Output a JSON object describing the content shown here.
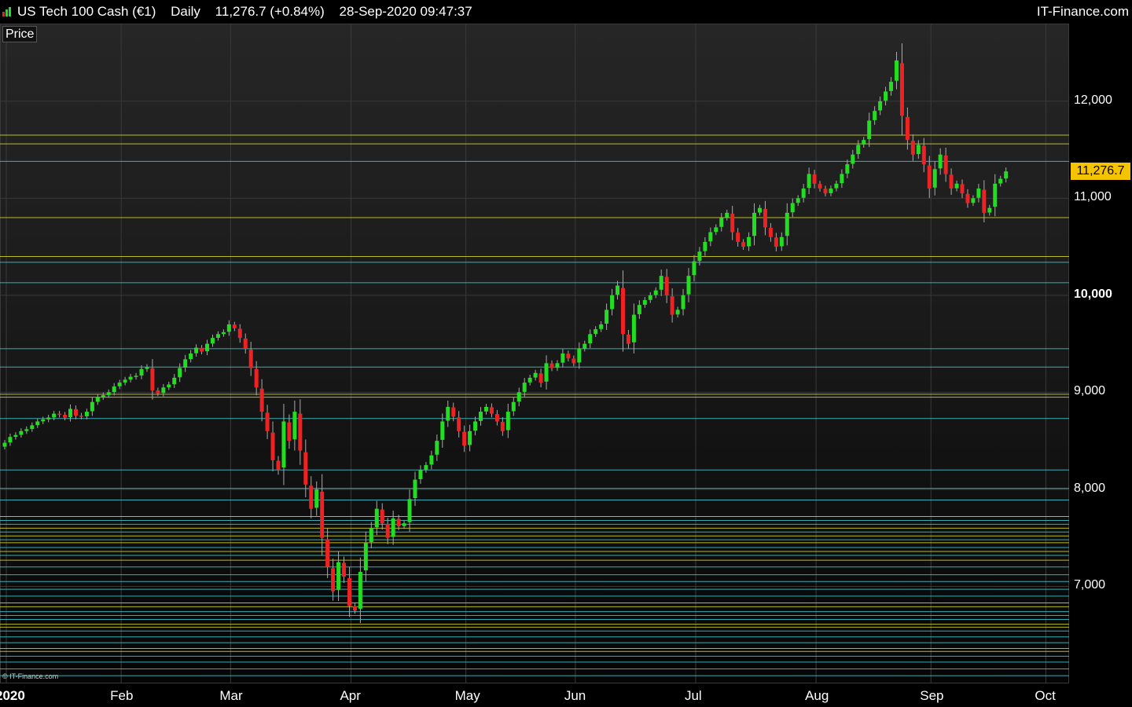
{
  "header": {
    "instrument": "US Tech 100 Cash (€1)",
    "period": "Daily",
    "quote": "11,276.7 (+0.84%)",
    "datetime": "28-Sep-2020 09:47:37",
    "brand": "IT-Finance.com"
  },
  "panel_label": "Price",
  "copyright": "© IT-Finance.com",
  "last_price_label": "11,276.7",
  "colors": {
    "up": "#22dd22",
    "down": "#ee2222",
    "level_yellow": "#d8d820",
    "level_cyan": "#40c8d0",
    "badge": "#f5c400"
  },
  "chart_data": {
    "type": "candlestick",
    "ylim": [
      6000,
      12800
    ],
    "y_ticks": [
      {
        "value": 12000,
        "label": "12,000",
        "bold": false
      },
      {
        "value": 11000,
        "label": "11,000",
        "bold": false
      },
      {
        "value": 10000,
        "label": "10,000",
        "bold": true
      },
      {
        "value": 9000,
        "label": "9,000",
        "bold": false
      },
      {
        "value": 8000,
        "label": "8,000",
        "bold": false
      },
      {
        "value": 7000,
        "label": "7,000",
        "bold": false
      }
    ],
    "x_ticks": [
      {
        "label": "2020",
        "bold": true,
        "index": 0
      },
      {
        "label": "Feb",
        "bold": false,
        "index": 21
      },
      {
        "label": "Mar",
        "bold": false,
        "index": 41
      },
      {
        "label": "Apr",
        "bold": false,
        "index": 63
      },
      {
        "label": "May",
        "bold": false,
        "index": 84
      },
      {
        "label": "Jun",
        "bold": false,
        "index": 104
      },
      {
        "label": "Jul",
        "bold": false,
        "index": 126
      },
      {
        "label": "Aug",
        "bold": false,
        "index": 148
      },
      {
        "label": "Sep",
        "bold": false,
        "index": 169
      },
      {
        "label": "Oct",
        "bold": false,
        "index": 190
      }
    ],
    "last_price": 11276.7,
    "horizontal_levels": [
      {
        "value": 11650,
        "color": "yellow"
      },
      {
        "value": 11560,
        "color": "yellow"
      },
      {
        "value": 11380,
        "color": "cyan"
      },
      {
        "value": 10800,
        "color": "yellow"
      },
      {
        "value": 10400,
        "color": "yellow"
      },
      {
        "value": 10340,
        "color": "cyan"
      },
      {
        "value": 10130,
        "color": "cyan"
      },
      {
        "value": 9450,
        "color": "cyan"
      },
      {
        "value": 9260,
        "color": "cyan"
      },
      {
        "value": 8980,
        "color": "yellow"
      },
      {
        "value": 8950,
        "color": "yellow"
      },
      {
        "value": 8730,
        "color": "cyan"
      },
      {
        "value": 8200,
        "color": "cyan"
      },
      {
        "value": 8010,
        "color": "cyan"
      },
      {
        "value": 7890,
        "color": "cyan"
      },
      {
        "value": 7720,
        "color": "yellow"
      },
      {
        "value": 7680,
        "color": "cyan"
      },
      {
        "value": 7640,
        "color": "cyan"
      },
      {
        "value": 7600,
        "color": "yellow"
      },
      {
        "value": 7560,
        "color": "cyan"
      },
      {
        "value": 7520,
        "color": "yellow"
      },
      {
        "value": 7480,
        "color": "cyan"
      },
      {
        "value": 7450,
        "color": "yellow"
      },
      {
        "value": 7400,
        "color": "cyan"
      },
      {
        "value": 7360,
        "color": "yellow"
      },
      {
        "value": 7320,
        "color": "cyan"
      },
      {
        "value": 7270,
        "color": "yellow"
      },
      {
        "value": 7200,
        "color": "cyan"
      },
      {
        "value": 7120,
        "color": "cyan"
      },
      {
        "value": 7050,
        "color": "cyan"
      },
      {
        "value": 6970,
        "color": "cyan"
      },
      {
        "value": 6900,
        "color": "cyan"
      },
      {
        "value": 6830,
        "color": "yellow"
      },
      {
        "value": 6790,
        "color": "yellow"
      },
      {
        "value": 6740,
        "color": "cyan"
      },
      {
        "value": 6700,
        "color": "cyan"
      },
      {
        "value": 6660,
        "color": "cyan"
      },
      {
        "value": 6610,
        "color": "yellow"
      },
      {
        "value": 6580,
        "color": "yellow"
      },
      {
        "value": 6540,
        "color": "cyan"
      },
      {
        "value": 6480,
        "color": "cyan"
      },
      {
        "value": 6420,
        "color": "cyan"
      },
      {
        "value": 6360,
        "color": "yellow"
      },
      {
        "value": 6330,
        "color": "yellow"
      },
      {
        "value": 6280,
        "color": "cyan"
      },
      {
        "value": 6220,
        "color": "cyan"
      },
      {
        "value": 6150,
        "color": "cyan"
      },
      {
        "value": 6080,
        "color": "cyan"
      }
    ],
    "closes": [
      8480,
      8540,
      8560,
      8600,
      8620,
      8660,
      8700,
      8720,
      8740,
      8780,
      8770,
      8740,
      8830,
      8760,
      8750,
      8800,
      8900,
      8950,
      8970,
      9000,
      9060,
      9100,
      9130,
      9160,
      9170,
      9240,
      9260,
      9020,
      8990,
      9050,
      9080,
      9150,
      9250,
      9340,
      9400,
      9460,
      9420,
      9500,
      9560,
      9600,
      9620,
      9700,
      9660,
      9560,
      9450,
      9250,
      9050,
      8800,
      8600,
      8300,
      8200,
      8700,
      8500,
      8800,
      8400,
      8050,
      7800,
      8000,
      7500,
      7200,
      6950,
      7250,
      7100,
      6800,
      6750,
      7150,
      7450,
      7600,
      7800,
      7650,
      7500,
      7700,
      7620,
      7650,
      7900,
      8100,
      8200,
      8250,
      8350,
      8500,
      8700,
      8850,
      8750,
      8600,
      8450,
      8600,
      8700,
      8800,
      8850,
      8780,
      8700,
      8600,
      8800,
      8900,
      9000,
      9100,
      9150,
      9200,
      9100,
      9300,
      9250,
      9300,
      9400,
      9350,
      9300,
      9450,
      9500,
      9600,
      9650,
      9700,
      9850,
      10000,
      10100,
      9600,
      9500,
      9800,
      9900,
      9950,
      10000,
      10050,
      10200,
      10000,
      9800,
      9850,
      10000,
      10200,
      10350,
      10450,
      10550,
      10650,
      10700,
      10800,
      10850,
      10650,
      10550,
      10500,
      10600,
      10850,
      10900,
      10700,
      10600,
      10500,
      10600,
      10850,
      10950,
      11000,
      11100,
      11250,
      11150,
      11100,
      11050,
      11100,
      11150,
      11250,
      11350,
      11450,
      11550,
      11600,
      11800,
      11900,
      12000,
      12100,
      12200,
      12420,
      11850,
      11600,
      11450,
      11550,
      11350,
      11100,
      11300,
      11450,
      11250,
      11100,
      11150,
      11050,
      10950,
      11000,
      11100,
      10850,
      10900,
      11150,
      11200,
      11276.7
    ]
  }
}
